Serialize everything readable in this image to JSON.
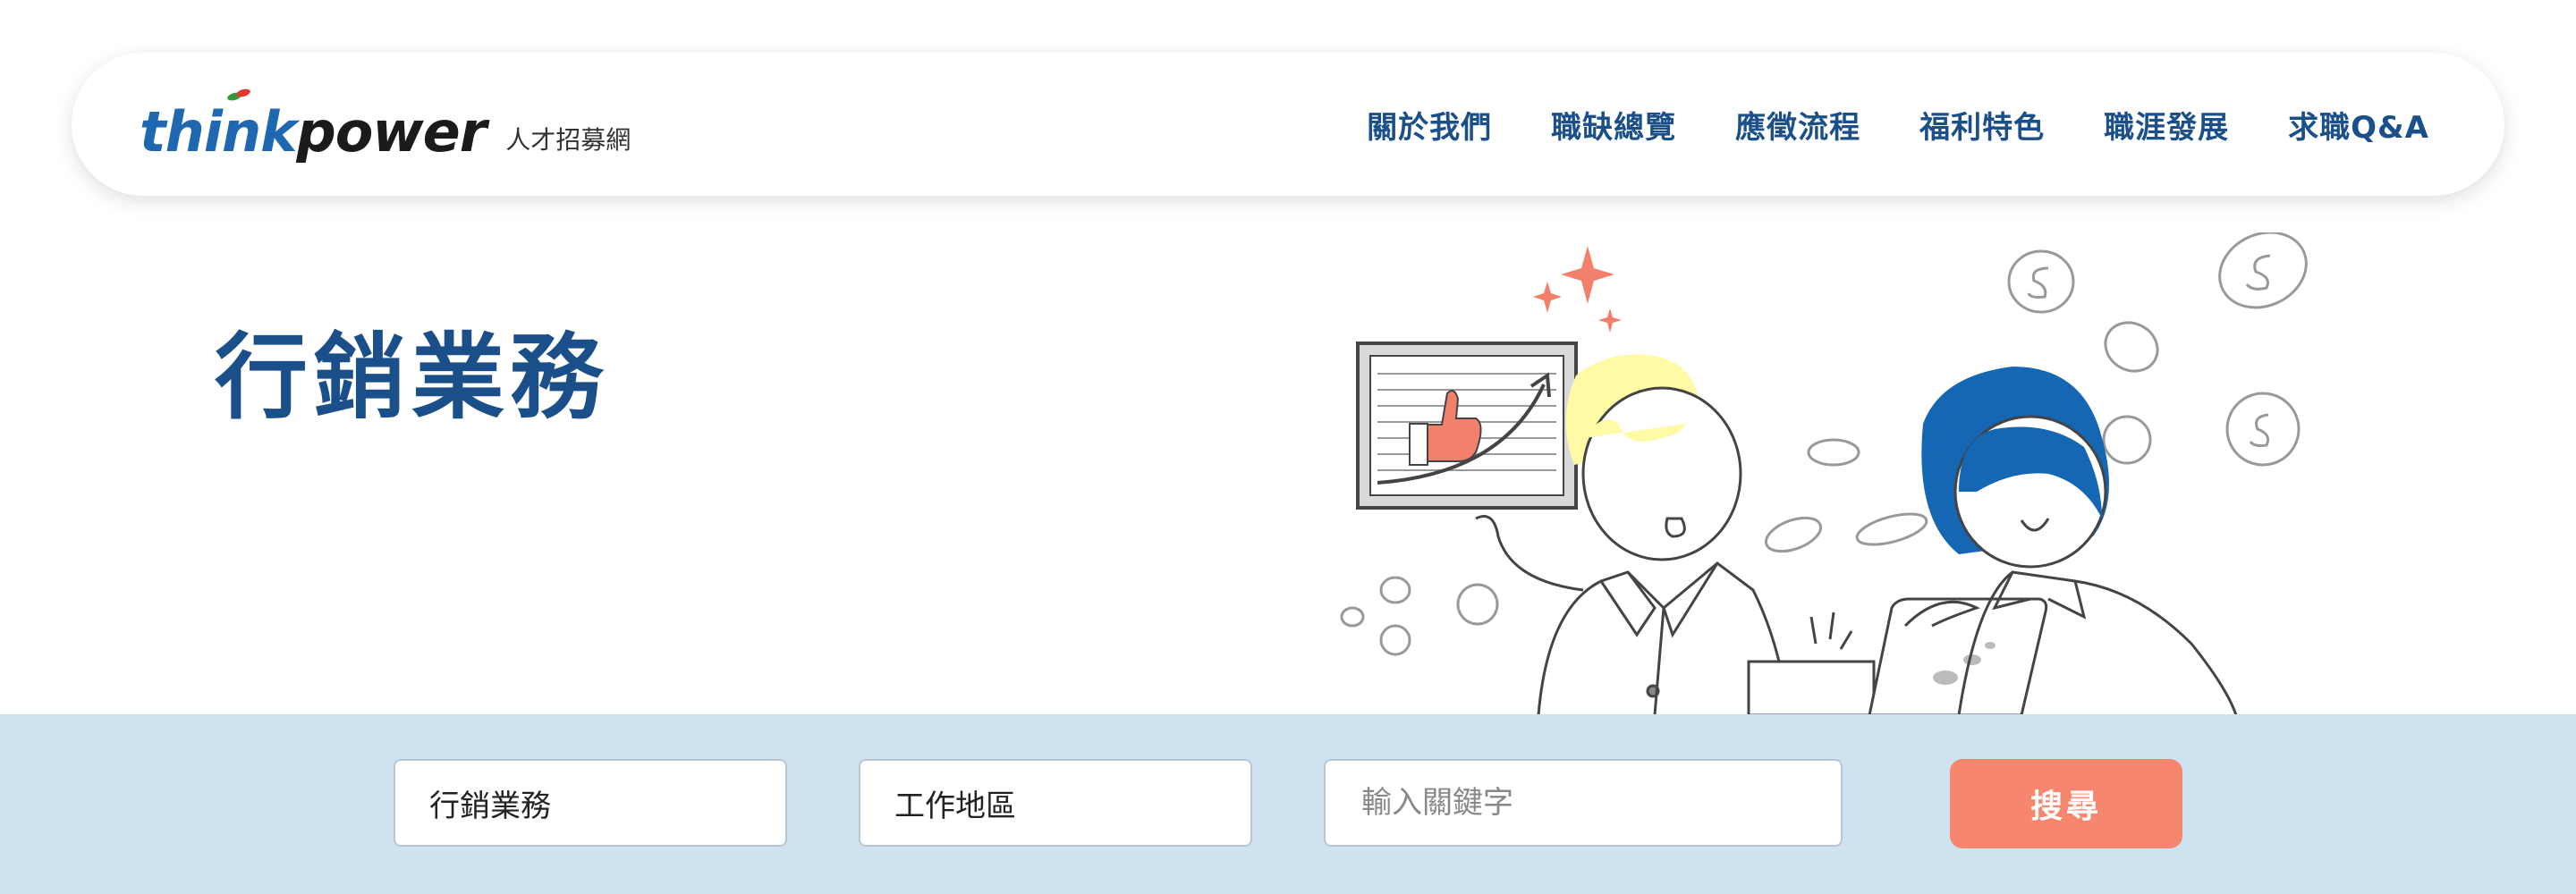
{
  "header": {
    "logo_think": "think",
    "logo_power": "power",
    "logo_subtitle": "人才招募網",
    "nav": [
      "關於我們",
      "職缺總覽",
      "應徵流程",
      "福利特色",
      "職涯發展",
      "求職Q&A"
    ]
  },
  "hero": {
    "title": "行銷業務"
  },
  "search": {
    "category_value": "行銷業務",
    "location_value": "工作地區",
    "keyword_placeholder": "輸入關鍵字",
    "button_label": "搜尋"
  },
  "colors": {
    "brand_blue": "#1b4f8a",
    "band_blue": "#cee2ef",
    "accent_coral": "#f6866e"
  }
}
